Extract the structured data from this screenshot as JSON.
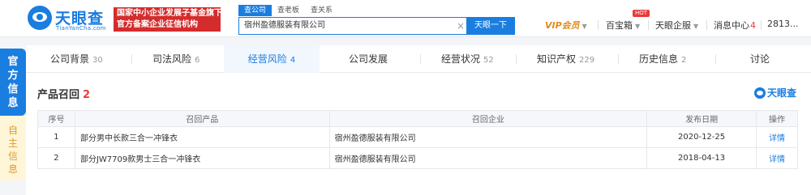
{
  "header": {
    "logo_name": "天眼查",
    "logo_url": "TianYanCha.com",
    "banner_line1": "国家中小企业发展子基金旗下",
    "banner_line2": "官方备案企业征信机构",
    "search_tabs": [
      "查公司",
      "查老板",
      "查关系"
    ],
    "search_value": "宿州盈德服装有限公司",
    "search_button": "天眼一下",
    "nav": {
      "vip": "VIP会员",
      "baibaoxiang": "百宝箱",
      "hot_badge": "HOT",
      "qiye": "天眼企服",
      "message": "消息中心",
      "message_count": "4",
      "user": "2813..."
    }
  },
  "side": {
    "official": "官方信息",
    "self": "自主信息"
  },
  "tabs": [
    {
      "label": "公司背景",
      "count": "30"
    },
    {
      "label": "司法风险",
      "count": "6"
    },
    {
      "label": "经营风险",
      "count": "4"
    },
    {
      "label": "公司发展",
      "count": ""
    },
    {
      "label": "经营状况",
      "count": "52"
    },
    {
      "label": "知识产权",
      "count": "229"
    },
    {
      "label": "历史信息",
      "count": "2"
    },
    {
      "label": "讨论",
      "count": ""
    }
  ],
  "section": {
    "title": "产品召回",
    "count": "2",
    "brand": "天眼查"
  },
  "table": {
    "headers": [
      "序号",
      "召回产品",
      "召回企业",
      "发布日期",
      "操作"
    ],
    "rows": [
      {
        "no": "1",
        "product": "部分男中长款三合一冲锋衣",
        "enterprise": "宿州盈德服装有限公司",
        "date": "2020-12-25",
        "action": "详情"
      },
      {
        "no": "2",
        "product": "部分JW7709款男士三合一冲锋衣",
        "enterprise": "宿州盈德服装有限公司",
        "date": "2018-04-13",
        "action": "详情"
      }
    ]
  },
  "colors": {
    "accent": "#1a7de0",
    "banner": "#d42c2c",
    "count_red": "#e83a3a",
    "vip": "#e28a1a"
  }
}
